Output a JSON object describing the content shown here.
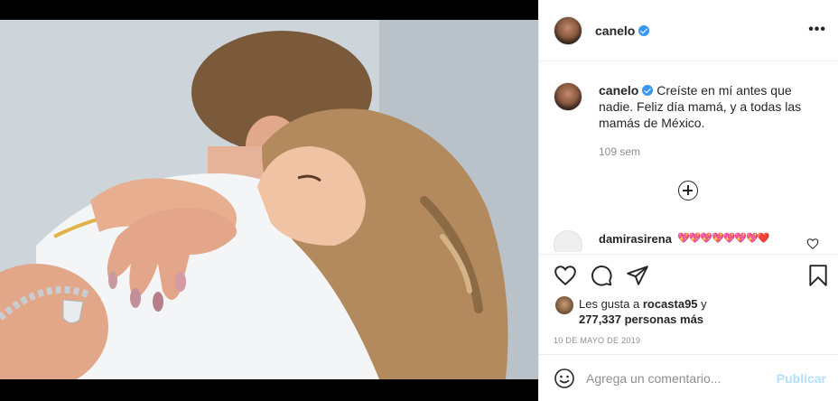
{
  "post": {
    "username": "canelo",
    "more_label": "•••"
  },
  "caption": {
    "username": "canelo",
    "text": "Creíste en mí antes que nadie. Feliz día mamá, y a todas las mamás de México.",
    "time": "109 sem"
  },
  "comments": [
    {
      "username": "damirasirena",
      "text": "💖💖💖💖💖💖💖❤️"
    }
  ],
  "likes": {
    "prefix": "Les gusta a ",
    "liker": "rocasta95",
    "suffix": " y",
    "count_text": "277,337 personas más"
  },
  "date": "10 DE MAYO DE 2019",
  "add_comment": {
    "placeholder": "Agrega un comentario...",
    "publish_label": "Publicar"
  },
  "icons": {
    "like": "heart-icon",
    "comment": "comment-icon",
    "share": "send-icon",
    "save": "bookmark-icon",
    "load_more": "plus-circle-icon",
    "emoji": "emoji-icon",
    "more": "more-options-icon",
    "verified": "verified-badge-icon"
  },
  "colors": {
    "verified": "#3897f0",
    "publish_disabled": "#b2dffc",
    "secondary_text": "#8e8e8e",
    "border": "#efefef"
  }
}
